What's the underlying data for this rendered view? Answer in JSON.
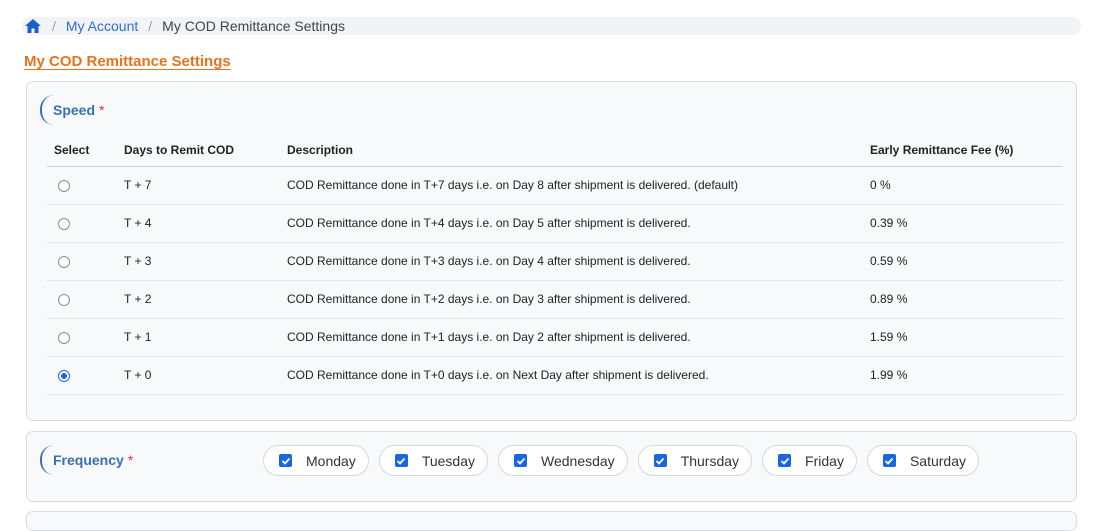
{
  "breadcrumb": {
    "home_icon": "home-icon",
    "separator": "/",
    "my_account": "My Account",
    "current": "My COD Remittance Settings"
  },
  "page_title": "My COD Remittance Settings",
  "speed": {
    "title": "Speed",
    "required_mark": "*",
    "headers": {
      "select": "Select",
      "days": "Days to Remit COD",
      "description": "Description",
      "fee": "Early Remittance Fee (%)"
    },
    "rows": [
      {
        "days": "T + 7",
        "description": "COD Remittance done in T+7 days i.e. on Day 8 after shipment is delivered. (default)",
        "fee": "0 %",
        "selected": false
      },
      {
        "days": "T + 4",
        "description": "COD Remittance done in T+4 days i.e. on Day 5 after shipment is delivered.",
        "fee": "0.39 %",
        "selected": false
      },
      {
        "days": "T + 3",
        "description": "COD Remittance done in T+3 days i.e. on Day 4 after shipment is delivered.",
        "fee": "0.59 %",
        "selected": false
      },
      {
        "days": "T + 2",
        "description": "COD Remittance done in T+2 days i.e. on Day 3 after shipment is delivered.",
        "fee": "0.89 %",
        "selected": false
      },
      {
        "days": "T + 1",
        "description": "COD Remittance done in T+1 days i.e. on Day 2 after shipment is delivered.",
        "fee": "1.59 %",
        "selected": false
      },
      {
        "days": "T + 0",
        "description": "COD Remittance done in T+0 days i.e. on Next Day after shipment is delivered.",
        "fee": "1.99 %",
        "selected": true
      }
    ]
  },
  "frequency": {
    "title": "Frequency",
    "required_mark": "*",
    "days": [
      {
        "label": "Monday",
        "checked": true
      },
      {
        "label": "Tuesday",
        "checked": true
      },
      {
        "label": "Wednesday",
        "checked": true
      },
      {
        "label": "Thursday",
        "checked": true
      },
      {
        "label": "Friday",
        "checked": true
      },
      {
        "label": "Saturday",
        "checked": true
      }
    ]
  },
  "colors": {
    "title_orange": "#e3741f",
    "link_blue": "#2c6fd1",
    "section_blue": "#3a6fb4",
    "checkbox_blue": "#1a66e0",
    "required_red": "#d9303a"
  }
}
